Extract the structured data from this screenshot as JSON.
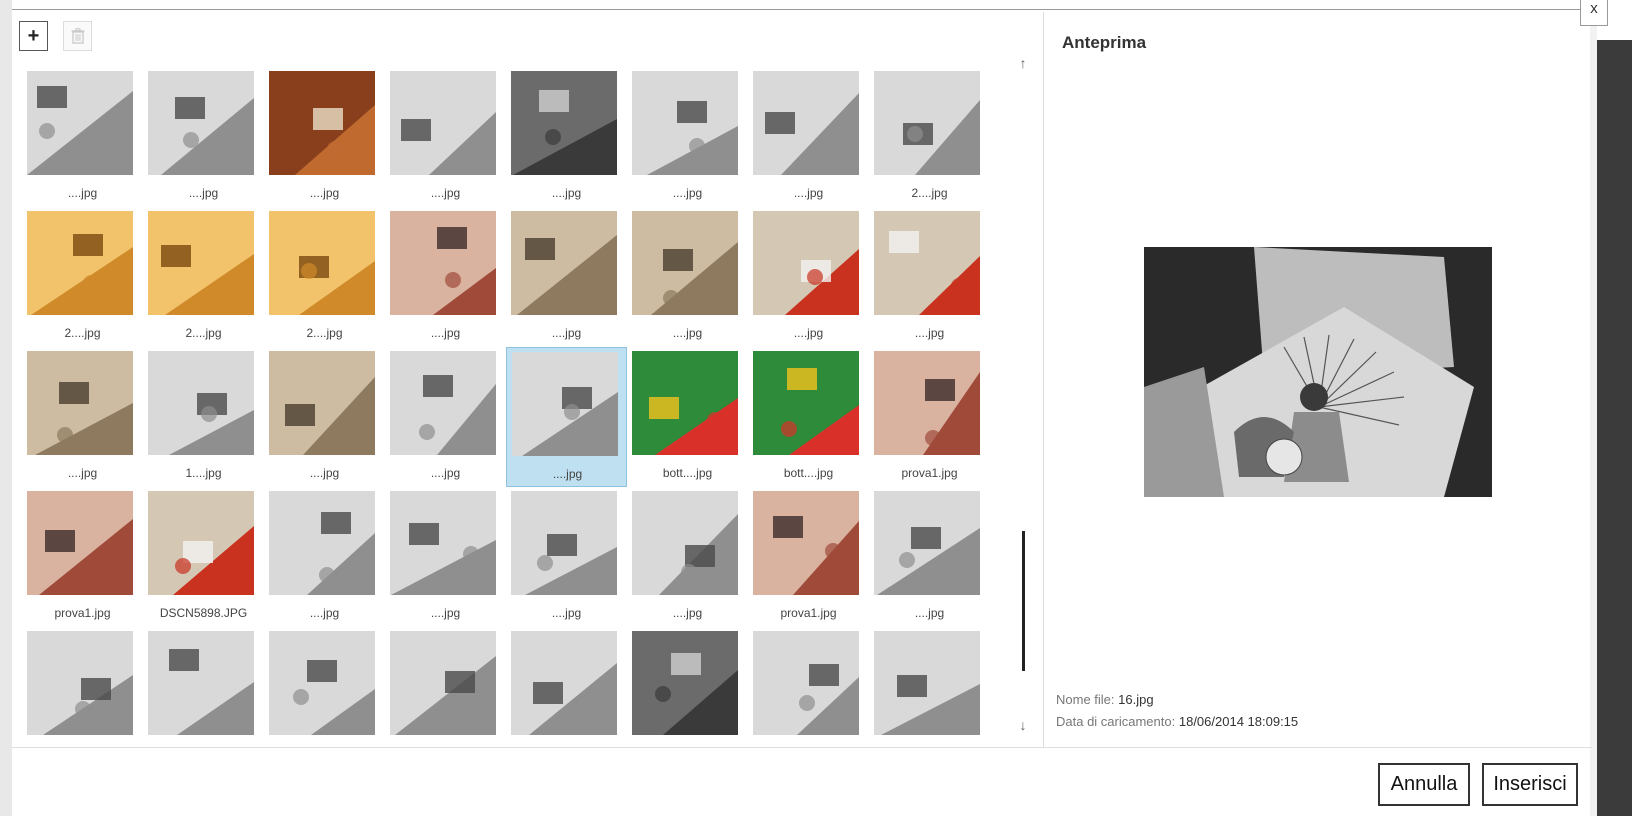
{
  "window": {
    "close_label": "x"
  },
  "toolbar": {
    "add_label": "+"
  },
  "colors": {
    "selected_bg": "#bfe0f0",
    "selected_border": "#8ec3df"
  },
  "gallery": {
    "selected_index": 20,
    "items": [
      {
        "name": "....jpg",
        "tone": "gray"
      },
      {
        "name": "....jpg",
        "tone": "gray"
      },
      {
        "name": "....jpg",
        "tone": "wood"
      },
      {
        "name": "....jpg",
        "tone": "gray"
      },
      {
        "name": "....jpg",
        "tone": "dark"
      },
      {
        "name": "....jpg",
        "tone": "gray"
      },
      {
        "name": "....jpg",
        "tone": "gray"
      },
      {
        "name": "2....jpg",
        "tone": "gray"
      },
      {
        "name": "2....jpg",
        "tone": "amber"
      },
      {
        "name": "2....jpg",
        "tone": "amber"
      },
      {
        "name": "2....jpg",
        "tone": "amber"
      },
      {
        "name": "....jpg",
        "tone": "warm"
      },
      {
        "name": "....jpg",
        "tone": "tan"
      },
      {
        "name": "....jpg",
        "tone": "tan"
      },
      {
        "name": "....jpg",
        "tone": "red"
      },
      {
        "name": "....jpg",
        "tone": "red"
      },
      {
        "name": "....jpg",
        "tone": "tan"
      },
      {
        "name": "1....jpg",
        "tone": "gray"
      },
      {
        "name": "....jpg",
        "tone": "tan"
      },
      {
        "name": "....jpg",
        "tone": "gray"
      },
      {
        "name": "....jpg",
        "tone": "gray"
      },
      {
        "name": "bott....jpg",
        "tone": "colorful"
      },
      {
        "name": "bott....jpg",
        "tone": "colorful"
      },
      {
        "name": "prova1.jpg",
        "tone": "warm"
      },
      {
        "name": "prova1.jpg",
        "tone": "warm"
      },
      {
        "name": "DSCN5898.JPG",
        "tone": "red"
      },
      {
        "name": "....jpg",
        "tone": "gray"
      },
      {
        "name": "....jpg",
        "tone": "gray"
      },
      {
        "name": "....jpg",
        "tone": "gray"
      },
      {
        "name": "....jpg",
        "tone": "gray"
      },
      {
        "name": "prova1.jpg",
        "tone": "warm"
      },
      {
        "name": "....jpg",
        "tone": "gray"
      },
      {
        "name": "",
        "tone": "gray"
      },
      {
        "name": "",
        "tone": "gray"
      },
      {
        "name": "",
        "tone": "gray"
      },
      {
        "name": "",
        "tone": "gray"
      },
      {
        "name": "",
        "tone": "gray"
      },
      {
        "name": "",
        "tone": "dark"
      },
      {
        "name": "",
        "tone": "gray"
      },
      {
        "name": "",
        "tone": "gray"
      }
    ]
  },
  "scroll": {
    "up_arrow": "↑",
    "down_arrow": "↓"
  },
  "preview": {
    "title": "Anteprima",
    "filename_label": "Nome file:",
    "filename_value": "16.jpg",
    "upload_label": "Data di caricamento:",
    "upload_value": "18/06/2014 18:09:15"
  },
  "actions": {
    "cancel_label": "Annulla",
    "insert_label": "Inserisci"
  }
}
